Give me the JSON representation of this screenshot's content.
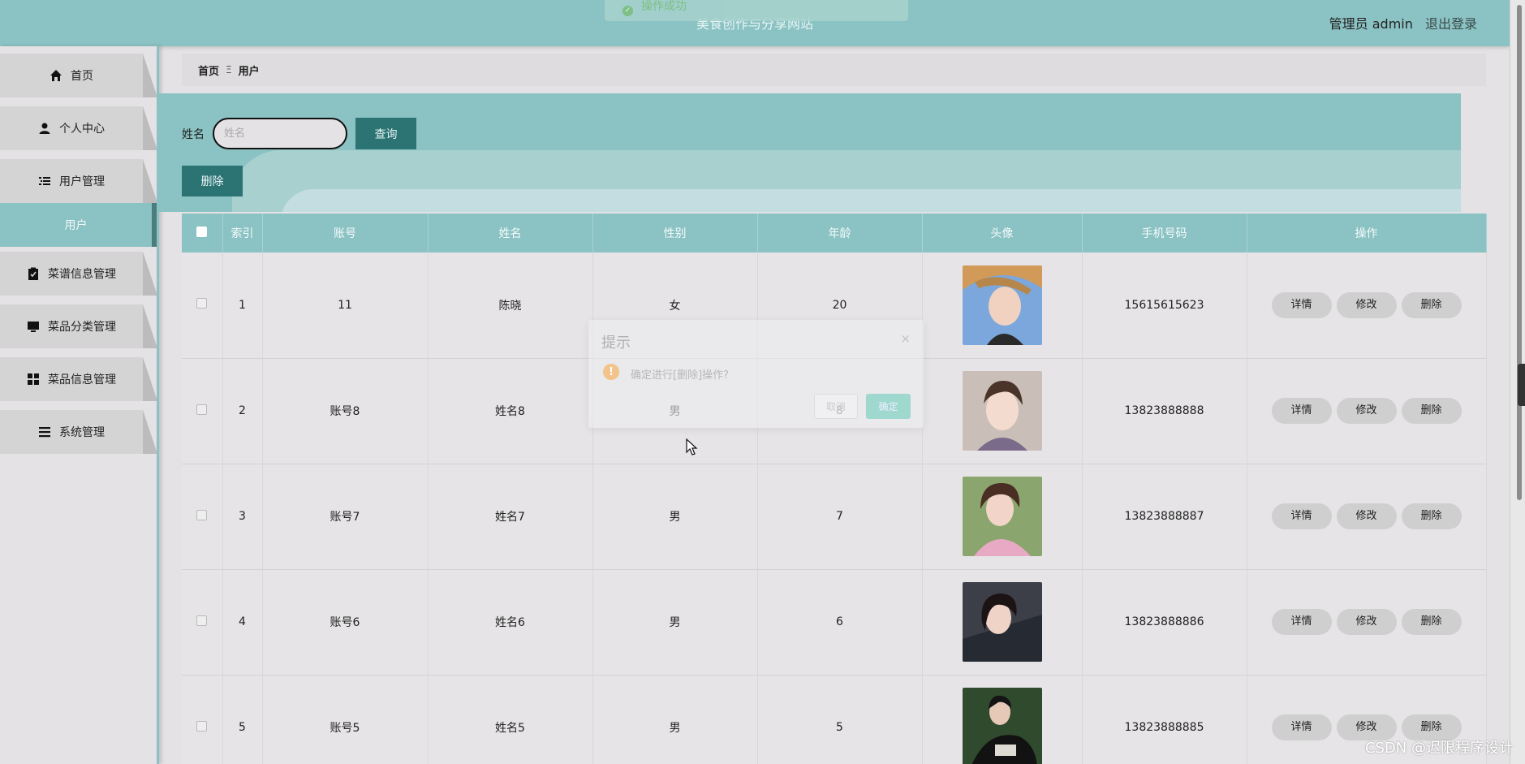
{
  "header": {
    "site_title": "美食创作与分享网站",
    "admin_label": "管理员 admin",
    "logout_label": "退出登录",
    "toast": "操作成功"
  },
  "sidebar": {
    "items": [
      {
        "label": "首页",
        "icon": "home-icon"
      },
      {
        "label": "个人中心",
        "icon": "user-icon"
      },
      {
        "label": "用户管理",
        "icon": "list-icon"
      },
      {
        "label": "菜谱信息管理",
        "icon": "clipboard-icon"
      },
      {
        "label": "菜品分类管理",
        "icon": "monitor-icon"
      },
      {
        "label": "菜品信息管理",
        "icon": "grid-icon"
      },
      {
        "label": "系统管理",
        "icon": "menu-icon"
      }
    ],
    "sub_active": "用户"
  },
  "breadcrumb": {
    "home": "首页",
    "separator": "Ξ",
    "current": "用户"
  },
  "search": {
    "label": "姓名",
    "placeholder": "姓名",
    "query_button": "查询",
    "delete_button": "删除"
  },
  "table": {
    "headers": [
      "索引",
      "账号",
      "姓名",
      "性别",
      "年龄",
      "头像",
      "手机号码",
      "操作"
    ],
    "rows": [
      {
        "index": "1",
        "account": "11",
        "name": "陈晓",
        "gender": "女",
        "age": "20",
        "phone": "15615615623"
      },
      {
        "index": "2",
        "account": "账号8",
        "name": "姓名8",
        "gender": "男",
        "age": "8",
        "phone": "13823888888"
      },
      {
        "index": "3",
        "account": "账号7",
        "name": "姓名7",
        "gender": "男",
        "age": "7",
        "phone": "13823888887"
      },
      {
        "index": "4",
        "account": "账号6",
        "name": "姓名6",
        "gender": "男",
        "age": "6",
        "phone": "13823888886"
      },
      {
        "index": "5",
        "account": "账号5",
        "name": "姓名5",
        "gender": "男",
        "age": "5",
        "phone": "13823888885"
      }
    ],
    "actions": {
      "detail": "详情",
      "edit": "修改",
      "delete": "删除"
    }
  },
  "dialog": {
    "title": "提示",
    "close": "×",
    "message": "确定进行[删除]操作?",
    "cancel": "取消",
    "confirm": "确定"
  },
  "watermark": "CSDN @迟限程序设计",
  "colors": {
    "accent": "#8bc2c3",
    "button_dark": "#2c7374",
    "page_bg": "#e4e2e4"
  }
}
